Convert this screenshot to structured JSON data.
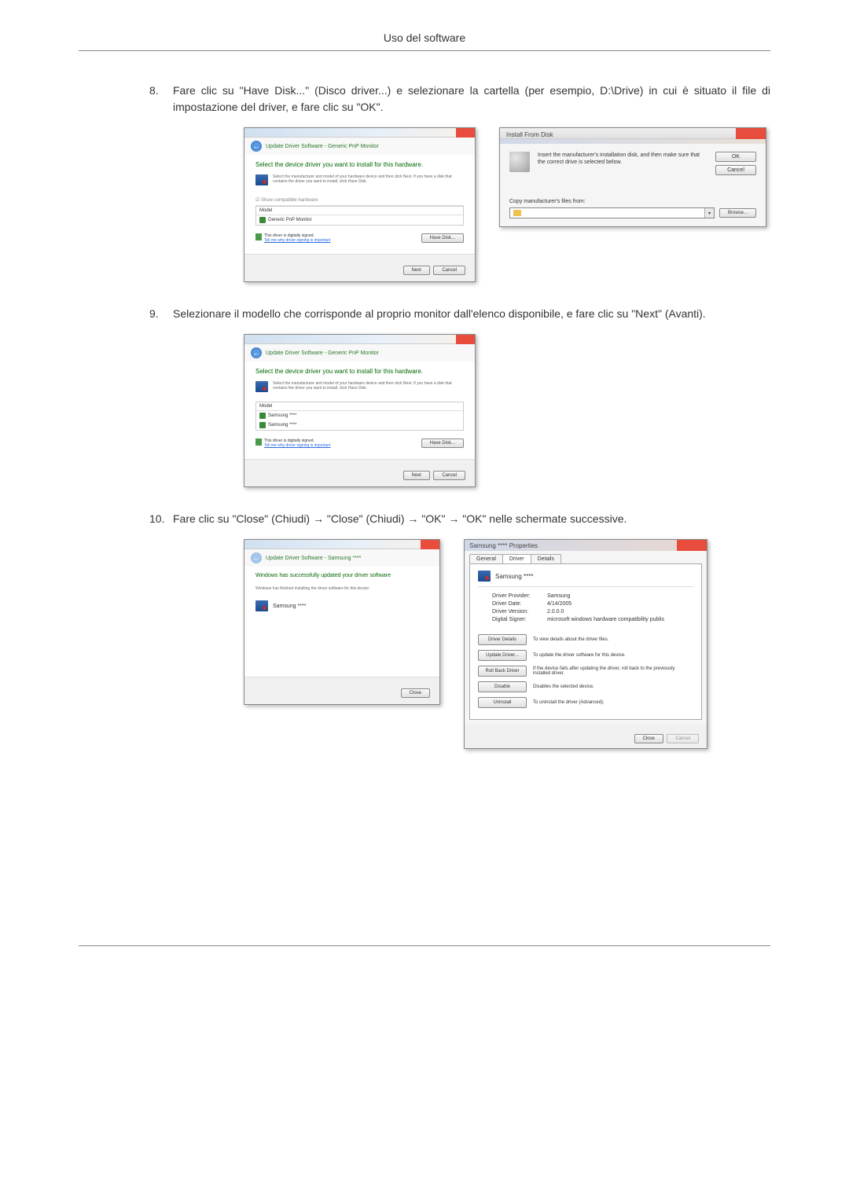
{
  "page": {
    "header": "Uso del software"
  },
  "steps": {
    "s8": {
      "num": "8.",
      "text": "Fare clic su \"Have Disk...\" (Disco driver...) e selezionare la cartella (per esempio, D:\\Drive) in cui è situato il file di impostazione del driver, e fare clic su \"OK\"."
    },
    "s9": {
      "num": "9.",
      "text": "Selezionare il modello che corrisponde al proprio monitor dall'elenco disponibile, e fare clic su \"Next\" (Avanti)."
    },
    "s10": {
      "num": "10.",
      "text": "Fare clic su \"Close\" (Chiudi) → \"Close\" (Chiudi) → \"OK\" → \"OK\" nelle schermate successive."
    }
  },
  "dlg8a": {
    "navTitle": "Update Driver Software - Generic PnP Monitor",
    "heading": "Select the device driver you want to install for this hardware.",
    "subtext": "Select the manufacturer and model of your hardware device and then click Next. If you have a disk that contains the driver you want to install, click Have Disk.",
    "showCompat": "☑ Show compatible hardware",
    "listHeader": "Model",
    "listItem": "Generic PnP Monitor",
    "signedText": "This driver is digitally signed.",
    "signedLink": "Tell me why driver signing is important",
    "haveDisk": "Have Disk...",
    "next": "Next",
    "cancel": "Cancel"
  },
  "dlg8b": {
    "title": "Install From Disk",
    "msg": "Insert the manufacturer's installation disk, and then make sure that the correct drive is selected below.",
    "ok": "OK",
    "cancel": "Cancel",
    "copyLabel": "Copy manufacturer's files from:",
    "comboValue": "",
    "browse": "Browse..."
  },
  "dlg9": {
    "navTitle": "Update Driver Software - Generic PnP Monitor",
    "heading": "Select the device driver you want to install for this hardware.",
    "subtext": "Select the manufacturer and model of your hardware device and then click Next. If you have a disk that contains the driver you want to install, click Have Disk.",
    "listHeader": "Model",
    "item1": "Samsung ****",
    "item2": "Samsung ****",
    "signedText": "This driver is digitally signed.",
    "signedLink": "Tell me why driver signing is important",
    "haveDisk": "Have Disk...",
    "next": "Next",
    "cancel": "Cancel"
  },
  "dlg10a": {
    "navTitle": "Update Driver Software - Samsung ****",
    "heading": "Windows has successfully updated your driver software",
    "sub": "Windows has finished installing the driver software for this device:",
    "device": "Samsung ****",
    "close": "Close"
  },
  "dlg10b": {
    "title": "Samsung **** Properties",
    "tabGeneral": "General",
    "tabDriver": "Driver",
    "tabDetails": "Details",
    "device": "Samsung ****",
    "provLabel": "Driver Provider:",
    "provValue": "Samsung",
    "dateLabel": "Driver Date:",
    "dateValue": "4/14/2005",
    "verLabel": "Driver Version:",
    "verValue": "2.0.0.0",
    "signerLabel": "Digital Signer:",
    "signerValue": "microsoft windows hardware compatibility publis",
    "btnDetails": "Driver Details",
    "btnDetailsDesc": "To view details about the driver files.",
    "btnUpdate": "Update Driver...",
    "btnUpdateDesc": "To update the driver software for this device.",
    "btnRollback": "Roll Back Driver",
    "btnRollbackDesc": "If the device fails after updating the driver, roll back to the previously installed driver.",
    "btnDisable": "Disable",
    "btnDisableDesc": "Disables the selected device.",
    "btnUninstall": "Uninstall",
    "btnUninstallDesc": "To uninstall the driver (Advanced).",
    "close": "Close",
    "cancel": "Cancel"
  }
}
